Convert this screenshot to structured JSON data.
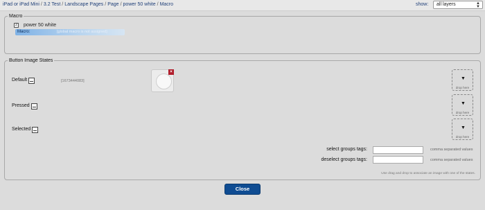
{
  "breadcrumb": [
    "iPad or iPad Mini",
    "3.2 Test",
    "Landscape Pages",
    "Page",
    "power 50 white",
    "Macro"
  ],
  "breadcrumb_separator": "/",
  "show": {
    "label": "show:",
    "value": "all layers"
  },
  "macro": {
    "legend": "Macro",
    "name": "power 50 white",
    "field_label": "Macro:",
    "field_placeholder": "[global macro is not assigned]"
  },
  "states": {
    "legend": "Button Image States",
    "items": [
      {
        "label": "Default",
        "id": "[1673444083]"
      },
      {
        "label": "Pressed",
        "id": ""
      },
      {
        "label": "Selected",
        "id": ""
      }
    ],
    "drop_text": "drop here",
    "select_tags_label": "select groups tags:",
    "deselect_tags_label": "deselect groups tags:",
    "tags_hint": "comma separated values",
    "footer_hint": "Use drag and drop to associate an image with one of the states."
  },
  "close_label": "Close"
}
